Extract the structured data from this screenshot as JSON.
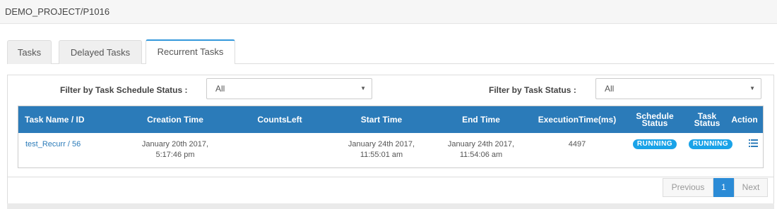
{
  "header": {
    "breadcrumb": "DEMO_PROJECT/P1016"
  },
  "tabs": [
    {
      "label": "Tasks"
    },
    {
      "label": "Delayed Tasks"
    },
    {
      "label": "Recurrent Tasks",
      "active": true
    }
  ],
  "filters": {
    "schedule_status": {
      "label": "Filter by Task Schedule Status :",
      "value": "All"
    },
    "task_status": {
      "label": "Filter by Task Status :",
      "value": "All"
    }
  },
  "table": {
    "columns": [
      "Task Name / ID",
      "Creation Time",
      "CountsLeft",
      "Start Time",
      "End Time",
      "ExecutionTime(ms)",
      "Schedule Status",
      "Task Status",
      "Action"
    ],
    "schedule_status_lines": [
      "Schedule",
      "Status"
    ],
    "task_status_lines": [
      "Task",
      "Status"
    ],
    "rows": [
      {
        "task_name": "test_Recurr / 56",
        "creation_time_line1": "January 20th 2017,",
        "creation_time_line2": "5:17:46 pm",
        "counts_left": "",
        "start_time_line1": "January 24th 2017,",
        "start_time_line2": "11:55:01 am",
        "end_time_line1": "January 24th 2017,",
        "end_time_line2": "11:54:06 am",
        "execution_time": "4497",
        "schedule_status": "RUNNING",
        "task_status": "RUNNING",
        "action_icon": "list-icon"
      }
    ]
  },
  "pagination": {
    "previous": "Previous",
    "current": "1",
    "next": "Next"
  },
  "colors": {
    "header_blue": "#2b7bb9",
    "badge_blue": "#1aa3e8",
    "tab_accent": "#3498db"
  }
}
